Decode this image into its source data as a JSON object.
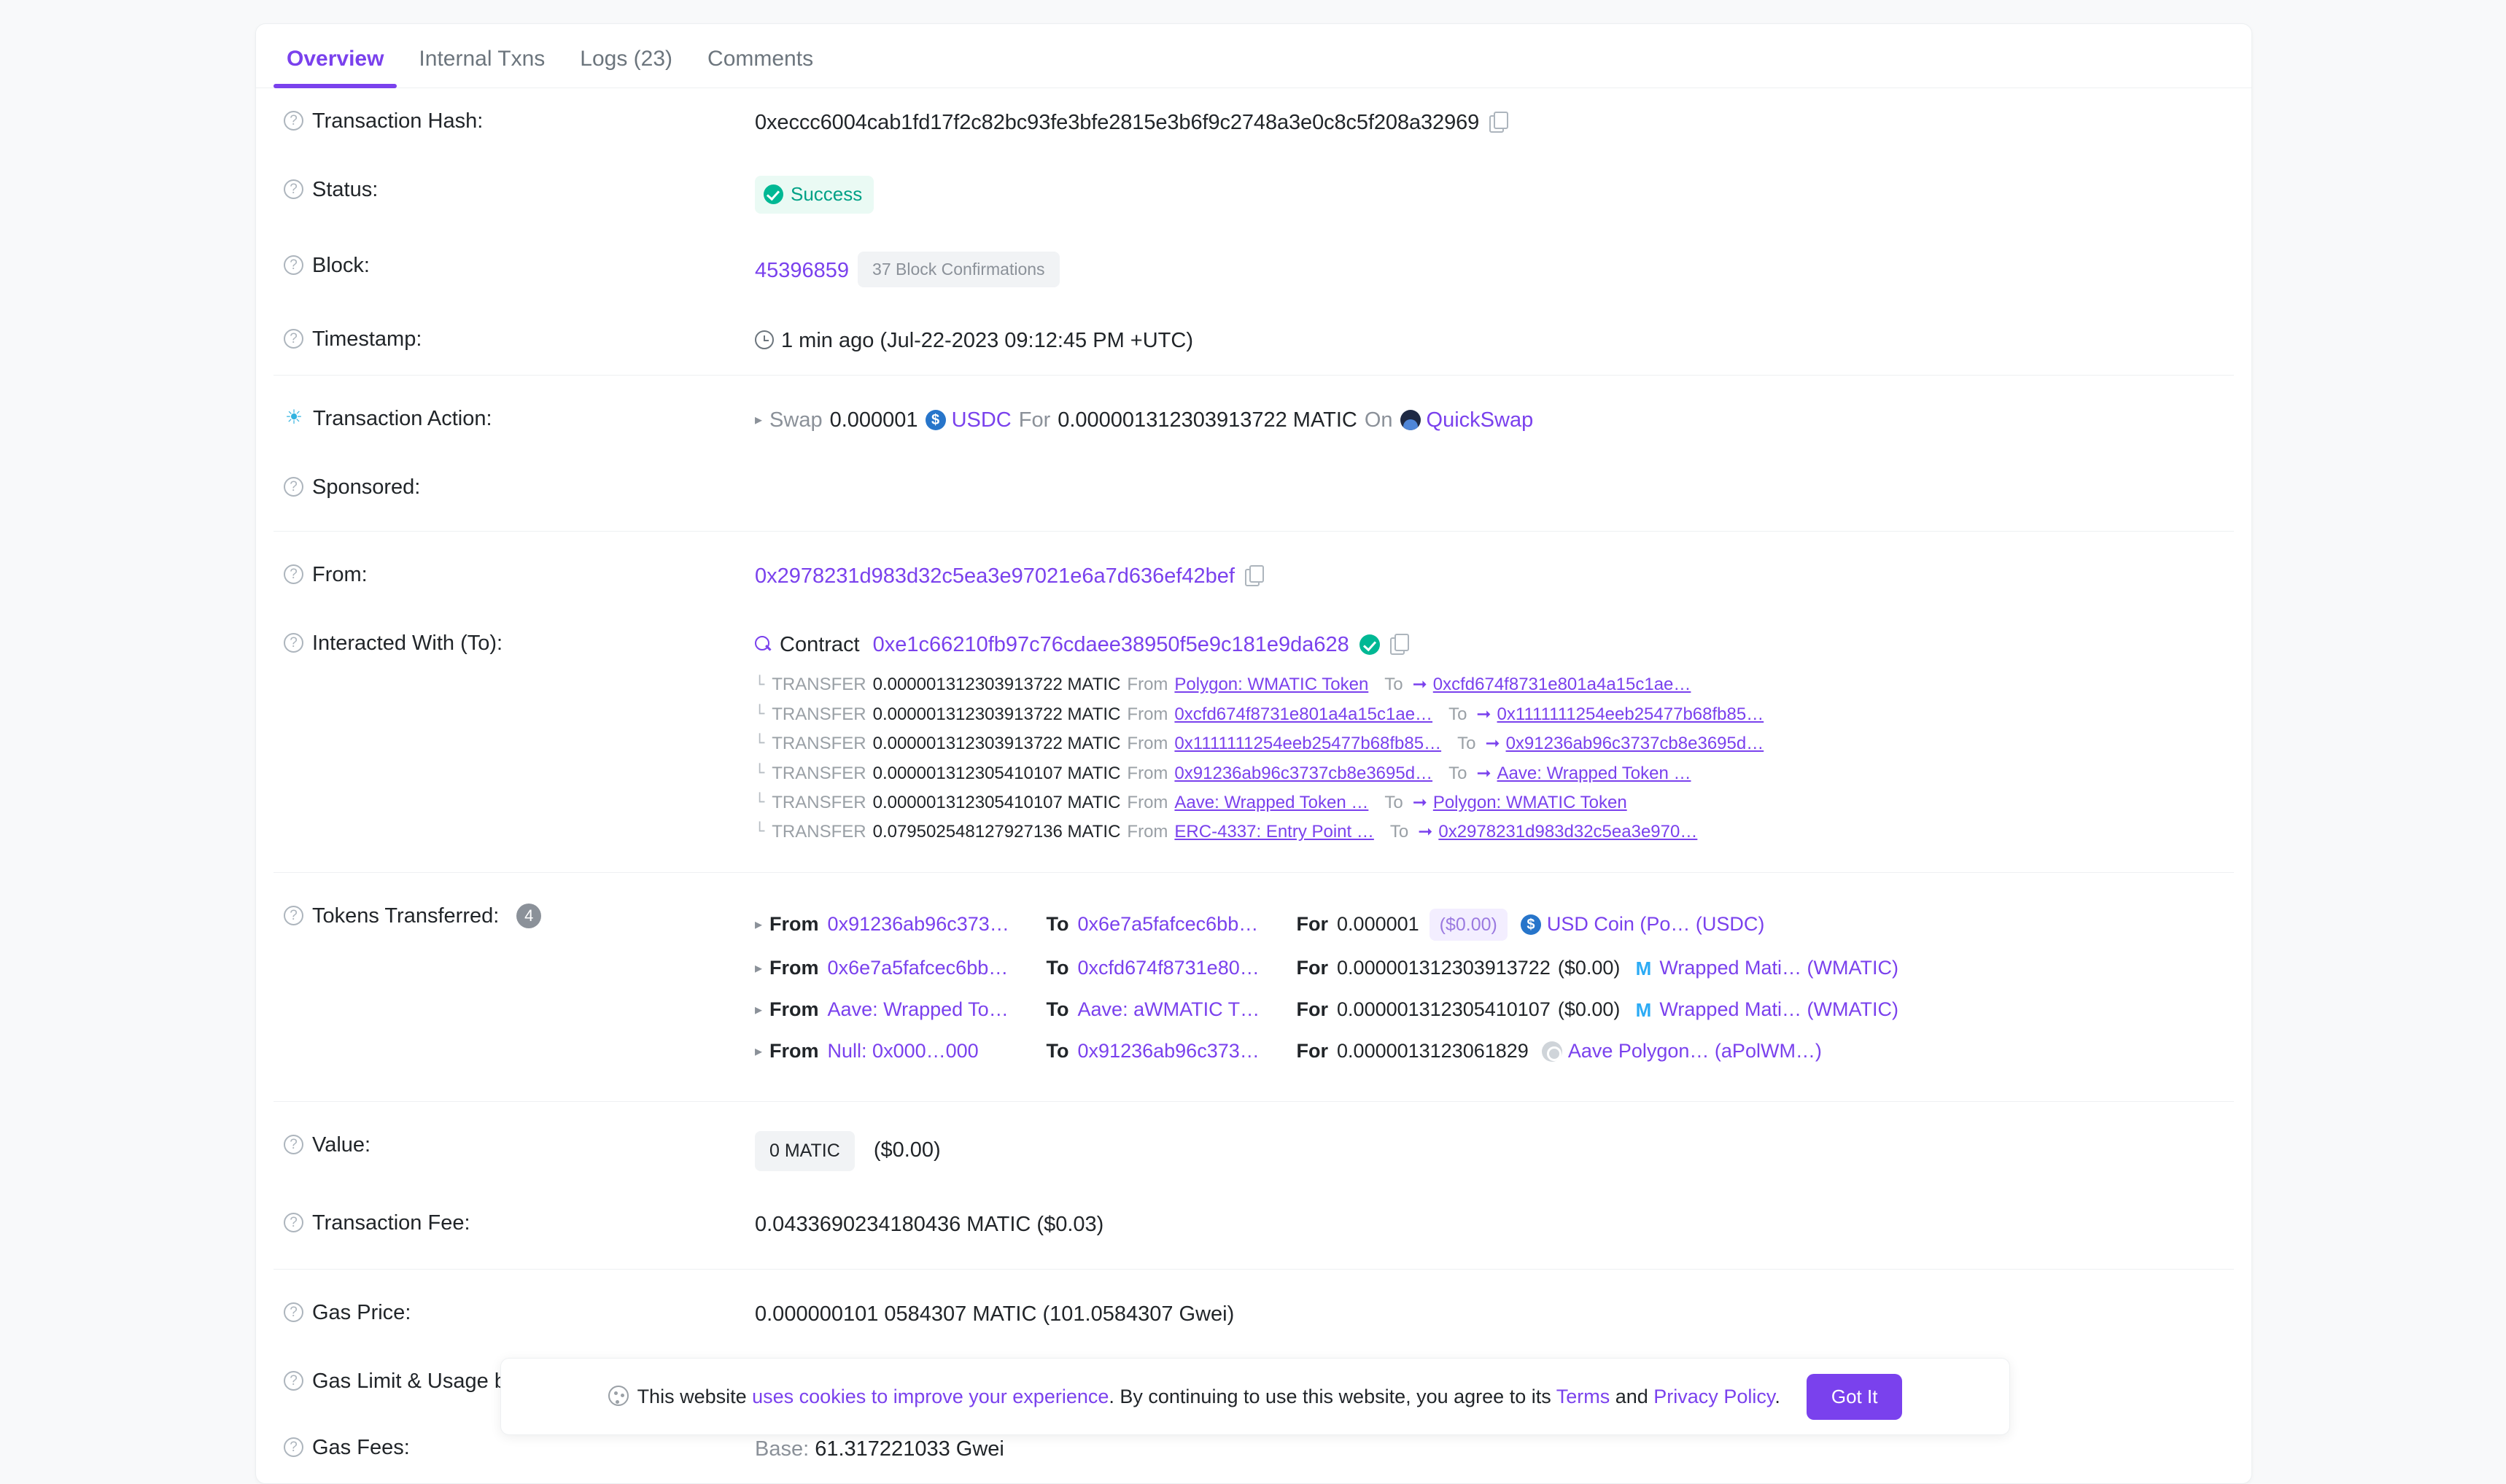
{
  "colors": {
    "accent": "#7a41ed",
    "success": "#00b894",
    "muted": "#8b9199",
    "page_bg": "#f8f9fa"
  },
  "tabs": [
    {
      "label": "Overview",
      "active": true
    },
    {
      "label": "Internal Txns",
      "active": false
    },
    {
      "label": "Logs (23)",
      "active": false
    },
    {
      "label": "Comments",
      "active": false
    }
  ],
  "overview": {
    "transaction_hash": {
      "label": "Transaction Hash:",
      "value": "0xeccc6004cab1fd17f2c82bc93fe3bfe2815e3b6f9c2748a3e0c8c5f208a32969"
    },
    "status": {
      "label": "Status:",
      "value": "Success"
    },
    "block": {
      "label": "Block:",
      "number": "45396859",
      "confirmations": "37 Block Confirmations"
    },
    "timestamp": {
      "label": "Timestamp:",
      "value": "1 min ago (Jul-22-2023 09:12:45 PM +UTC)"
    },
    "transaction_action": {
      "label": "Transaction Action:",
      "verb": "Swap",
      "amount_in": "0.000001",
      "token_in": "USDC",
      "for_word": "For",
      "amount_out": "0.000001312303913722 MATIC",
      "on_word": "On",
      "platform": "QuickSwap"
    },
    "sponsored": {
      "label": "Sponsored:",
      "value": ""
    },
    "from": {
      "label": "From:",
      "address": "0x2978231d983d32c5ea3e97021e6a7d636ef42bef"
    },
    "interacted_with": {
      "label": "Interacted With (To):",
      "contract_word": "Contract",
      "address": "0xe1c66210fb97c76cdaee38950f5e9c181e9da628",
      "transfers": [
        {
          "kind": "TRANSFER",
          "amount": "0.000001312303913722 MATIC",
          "from_label": "From",
          "from": "Polygon: WMATIC Token",
          "to_label": "To",
          "to": "0xcfd674f8731e801a4a15c1ae…"
        },
        {
          "kind": "TRANSFER",
          "amount": "0.000001312303913722 MATIC",
          "from_label": "From",
          "from": "0xcfd674f8731e801a4a15c1ae…",
          "to_label": "To",
          "to": "0x1111111254eeb25477b68fb85…"
        },
        {
          "kind": "TRANSFER",
          "amount": "0.000001312303913722 MATIC",
          "from_label": "From",
          "from": "0x1111111254eeb25477b68fb85…",
          "to_label": "To",
          "to": "0x91236ab96c3737cb8e3695d…"
        },
        {
          "kind": "TRANSFER",
          "amount": "0.000001312305410107 MATIC",
          "from_label": "From",
          "from": "0x91236ab96c3737cb8e3695d…",
          "to_label": "To",
          "to": "Aave: Wrapped Token …"
        },
        {
          "kind": "TRANSFER",
          "amount": "0.000001312305410107 MATIC",
          "from_label": "From",
          "from": "Aave: Wrapped Token …",
          "to_label": "To",
          "to": "Polygon: WMATIC Token"
        },
        {
          "kind": "TRANSFER",
          "amount": "0.079502548127927136 MATIC",
          "from_label": "From",
          "from": "ERC-4337: Entry Point …",
          "to_label": "To",
          "to": "0x2978231d983d32c5ea3e970…"
        }
      ]
    },
    "tokens_transferred": {
      "label": "Tokens Transferred:",
      "count": "4",
      "from_word": "From",
      "to_word": "To",
      "for_word": "For",
      "items": [
        {
          "from": "0x91236ab96c373…",
          "to": "0x6e7a5fafcec6bb…",
          "amount": "0.000001",
          "usd": "($0.00)",
          "usd_style": "pill",
          "token_icon": "usdc-icon",
          "token": "USD Coin (Po… (USDC)"
        },
        {
          "from": "0x6e7a5fafcec6bb…",
          "to": "0xcfd674f8731e80…",
          "amount": "0.000001312303913722",
          "usd": "($0.00)",
          "usd_style": "plain",
          "token_icon": "wmatic-icon",
          "token": "Wrapped Mati… (WMATIC)"
        },
        {
          "from": "Aave: Wrapped To…",
          "to": "Aave: aWMATIC T…",
          "amount": "0.000001312305410107",
          "usd": "($0.00)",
          "usd_style": "plain",
          "token_icon": "wmatic-icon",
          "token": "Wrapped Mati… (WMATIC)"
        },
        {
          "from": "Null: 0x000…000",
          "to": "0x91236ab96c373…",
          "amount": "0.0000013123061829",
          "usd": "",
          "usd_style": "none",
          "token_icon": "apolwmatic-icon",
          "token": "Aave Polygon… (aPolWM…)"
        }
      ]
    },
    "value": {
      "label": "Value:",
      "amount": "0 MATIC",
      "usd": "($0.00)"
    },
    "transaction_fee": {
      "label": "Transaction Fee:",
      "value": "0.0433690234180436 MATIC ($0.03)"
    },
    "gas_price": {
      "label": "Gas Price:",
      "value": "0.000000101 0584307 MATIC (101.0584307 Gwei)"
    },
    "gas_limit_usage": {
      "label": "Gas Limit & Usage by",
      "value": ""
    },
    "gas_fees": {
      "label": "Gas Fees:",
      "base_label": "Base:",
      "base_value": "61.317221033 Gwei"
    }
  },
  "cookie_banner": {
    "prefix": "This website ",
    "link1": "uses cookies to improve your experience",
    "middle": ". By continuing to use this website, you agree to its ",
    "link2": "Terms",
    "and": " and ",
    "link3": "Privacy Policy",
    "suffix": ".",
    "button": "Got It"
  }
}
